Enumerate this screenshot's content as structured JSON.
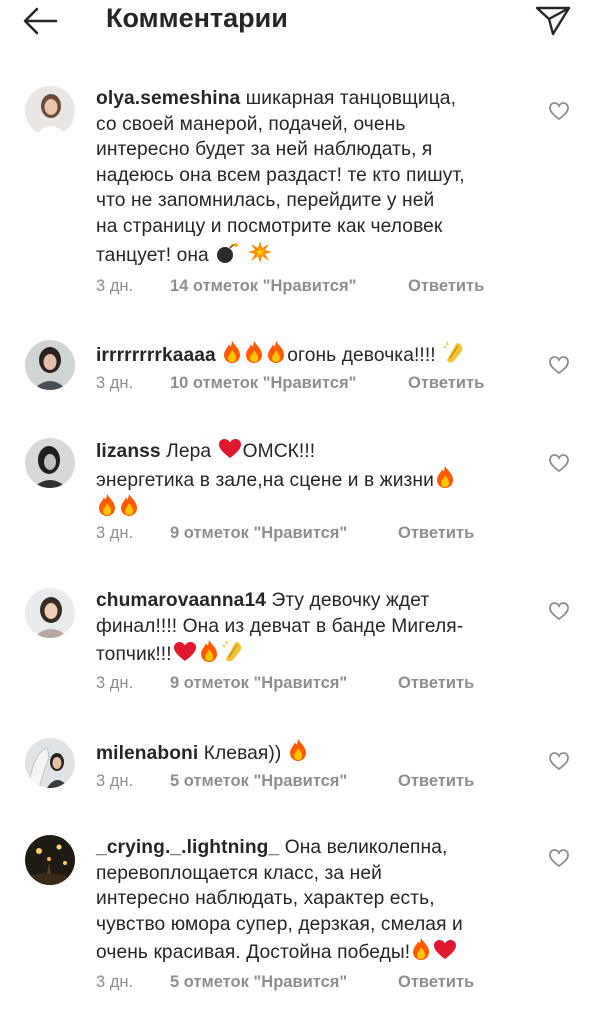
{
  "header": {
    "title": "Комментарии",
    "back_icon": "arrow-left-icon",
    "send_icon": "paper-plane-icon"
  },
  "comments": [
    {
      "username": "olya.semeshina",
      "lines": [
        "шикарная танцовщица,",
        "со своей манерой, подачей, очень",
        "интересно будет за ней наблюдать, я",
        "надеюсь она всем раздаст! те кто пишут,",
        "что не запомнилась, перейдите у ней",
        "на страницу и посмотрите как человек",
        "танцует! она"
      ],
      "emojis": [
        "bomb-emoji",
        "collision-emoji"
      ],
      "time": "3 дн.",
      "likes": "14 отметок \"Нравится\"",
      "reply": "Ответить"
    },
    {
      "username": "irrrrrrrrkaaaa",
      "lines": [
        "огонь девочка!!!!"
      ],
      "emojis": [
        "fire-emoji",
        "fire-emoji",
        "fire-emoji",
        "clapping-hands-emoji"
      ],
      "time": "3 дн.",
      "likes": "10 отметок \"Нравится\"",
      "reply": "Ответить"
    },
    {
      "username": "lizanss",
      "lines": [
        "Лера",
        "ОМСК!!!",
        "энергетика в зале,на сцене и в жизни"
      ],
      "emojis": [
        "heart-emoji",
        "fire-emoji",
        "fire-emoji",
        "fire-emoji"
      ],
      "time": "3 дн.",
      "likes": "9 отметок \"Нравится\"",
      "reply": "Ответить"
    },
    {
      "username": "chumarovaanna14",
      "lines": [
        "Эту девочку  ждет",
        "финал!!!! Она из девчат в банде Мигеля-",
        "топчик!!!"
      ],
      "emojis": [
        "heart-emoji",
        "fire-emoji",
        "clapping-hands-emoji"
      ],
      "time": "3 дн.",
      "likes": "9 отметок \"Нравится\"",
      "reply": "Ответить"
    },
    {
      "username": "milenaboni",
      "lines": [
        "Клевая))"
      ],
      "emojis": [
        "fire-emoji"
      ],
      "time": "3 дн.",
      "likes": "5 отметок \"Нравится\"",
      "reply": "Ответить"
    },
    {
      "username": "_crying._.lightning_",
      "lines": [
        "Она великолепна,",
        "перевоплощается класс, за ней",
        "интересно наблюдать, характер есть,",
        "чувство юмора супер, дерзкая, смелая и",
        "очень красивая.  Достойна победы!"
      ],
      "emojis": [
        "fire-emoji",
        "heart-emoji"
      ],
      "time": "3 дн.",
      "likes": "5 отметок \"Нравится\"",
      "reply": "Ответить"
    }
  ],
  "colors": {
    "text": "#262626",
    "meta": "#8e8e8e",
    "fire": "#ff6a00",
    "heart": "#e0182d",
    "clap": "#f2c230"
  },
  "icons": {
    "like": "heart-outline-icon"
  }
}
